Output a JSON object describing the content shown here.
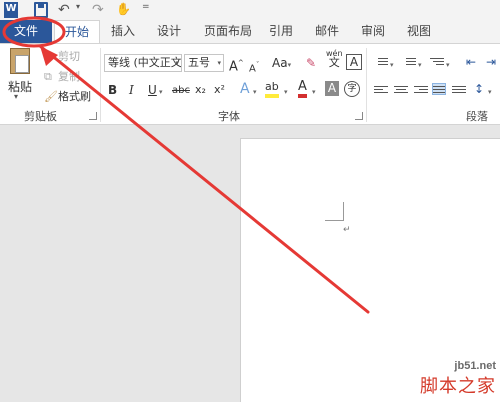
{
  "app": {
    "logo_letter": "W"
  },
  "quick_access": {
    "undo": "↶",
    "redo": "↷",
    "touch": "✋",
    "customize": "="
  },
  "tabs": [
    {
      "label": "文件",
      "kind": "file"
    },
    {
      "label": "开始",
      "kind": "active"
    },
    {
      "label": "插入"
    },
    {
      "label": "设计"
    },
    {
      "label": "页面布局"
    },
    {
      "label": "引用"
    },
    {
      "label": "邮件"
    },
    {
      "label": "审阅"
    },
    {
      "label": "视图"
    }
  ],
  "clipboard": {
    "paste_label": "粘贴",
    "cut_label": "剪切",
    "copy_label": "复制",
    "format_painter_label": "格式刷",
    "group_label": "剪贴板"
  },
  "font": {
    "font_name": "等线 (中文正文",
    "font_size": "五号",
    "grow": "A",
    "shrink": "A",
    "change_case": "Aa",
    "phonetic_top": "wén",
    "phonetic_bottom": "文",
    "char_border": "A",
    "bold": "B",
    "italic": "I",
    "underline": "U",
    "strike": "abc",
    "subscript": "x₂",
    "superscript": "x²",
    "text_effect": "A",
    "highlight": "ab",
    "font_color": "A",
    "char_shading": "A",
    "enclose": "字",
    "group_label": "字体"
  },
  "paragraph": {
    "group_label": "段落"
  },
  "document": {
    "para_mark": "↵"
  },
  "watermark": {
    "url": "jb51.net",
    "name": "脚本之家"
  },
  "colors": {
    "accent": "#2b579a",
    "annotation": "#e53935",
    "highlight": "#ffeb3b",
    "font_color": "#d32f2f"
  }
}
